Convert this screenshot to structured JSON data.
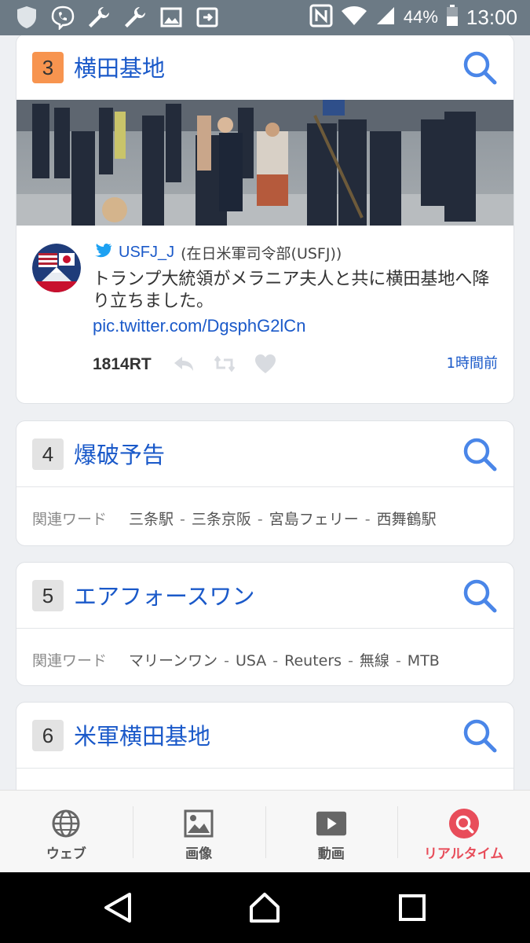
{
  "status_bar": {
    "battery": "44%",
    "time": "13:00",
    "left_icons": [
      "shield-icon",
      "viber-icon",
      "wrench-icon",
      "wrench-icon",
      "image-icon",
      "cast-icon"
    ],
    "right_icons": [
      "nfc-icon",
      "wifi-icon",
      "signal-icon",
      "battery-icon"
    ]
  },
  "cards": [
    {
      "rank": "3",
      "keyword": "横田基地",
      "tweet": {
        "username": "USFJ_J",
        "display_name": "(在日米軍司令部(USFJ))",
        "text": "トランプ大統領がメラニア夫人と共に横田基地へ降り立ちました。",
        "link": "pic.twitter.com/DgsphG2lCn",
        "retweets": "1814RT",
        "time": "1時間前"
      }
    },
    {
      "rank": "4",
      "keyword": "爆破予告",
      "related_label": "関連ワード",
      "related": [
        "三条駅",
        "三条京阪",
        "宮島フェリー",
        "西舞鶴駅"
      ]
    },
    {
      "rank": "5",
      "keyword": "エアフォースワン",
      "related_label": "関連ワード",
      "related": [
        "マリーンワン",
        "USA",
        "Reuters",
        "無線",
        "MTB"
      ]
    },
    {
      "rank": "6",
      "keyword": "米軍横田基地"
    }
  ],
  "colors": {
    "link": "#1a59c9",
    "rank_hot": "#f7944f",
    "active_tab": "#e84d5a",
    "search_icon": "#4a86e8"
  },
  "bottom_nav": [
    {
      "label": "ウェブ",
      "icon": "globe-icon"
    },
    {
      "label": "画像",
      "icon": "image-icon"
    },
    {
      "label": "動画",
      "icon": "play-icon"
    },
    {
      "label": "リアルタイム",
      "icon": "realtime-search-icon",
      "active": true
    }
  ],
  "system_nav": [
    "back-icon",
    "home-icon",
    "recents-icon"
  ]
}
